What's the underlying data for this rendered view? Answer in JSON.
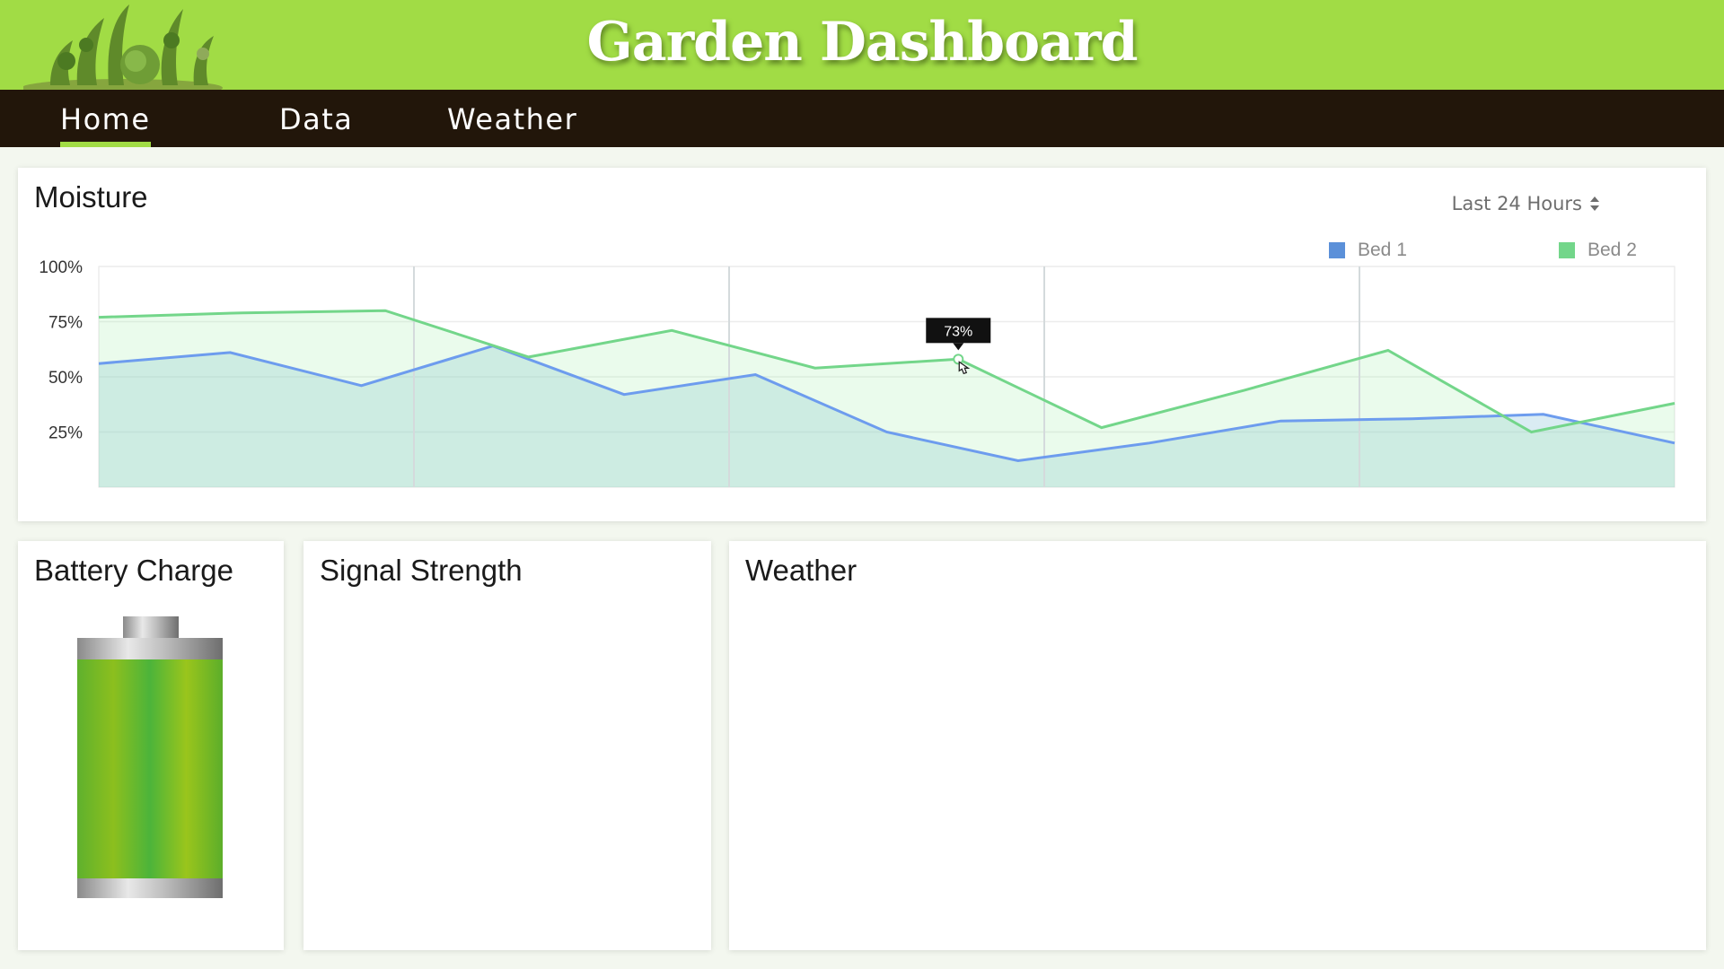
{
  "header": {
    "title": "Garden Dashboard"
  },
  "nav": {
    "tabs": [
      {
        "label": "Home",
        "active": true
      },
      {
        "label": "Data",
        "active": false
      },
      {
        "label": "Weather",
        "active": false
      }
    ]
  },
  "moisture": {
    "title": "Moisture",
    "range_select": "Last 24 Hours",
    "tooltip": "73%"
  },
  "battery": {
    "title": "Battery Charge",
    "level": 1.0
  },
  "signal": {
    "title": "Signal Strength"
  },
  "weather": {
    "title": "Weather"
  },
  "colors": {
    "header": "#a1dc45",
    "nav": "#22160a",
    "bed1": "#6d9cee",
    "bed2": "#73d68a"
  },
  "chart_data": {
    "type": "area",
    "title": "Moisture",
    "xlabel": "",
    "ylabel": "",
    "ylim": [
      0,
      100
    ],
    "yticks": [
      "100%",
      "75%",
      "50%",
      "25%"
    ],
    "ytick_values": [
      100,
      75,
      50,
      25
    ],
    "grid": true,
    "legend_position": "top-right",
    "series": [
      {
        "name": "Bed 1",
        "color": "#6d9cee",
        "values": [
          56,
          61,
          46,
          64,
          42,
          51,
          25,
          12,
          20,
          30,
          31,
          33,
          20
        ]
      },
      {
        "name": "Bed 2",
        "color": "#73d68a",
        "values": [
          77,
          79,
          80,
          59,
          71,
          54,
          58,
          27,
          44,
          62,
          25,
          38
        ]
      }
    ]
  }
}
